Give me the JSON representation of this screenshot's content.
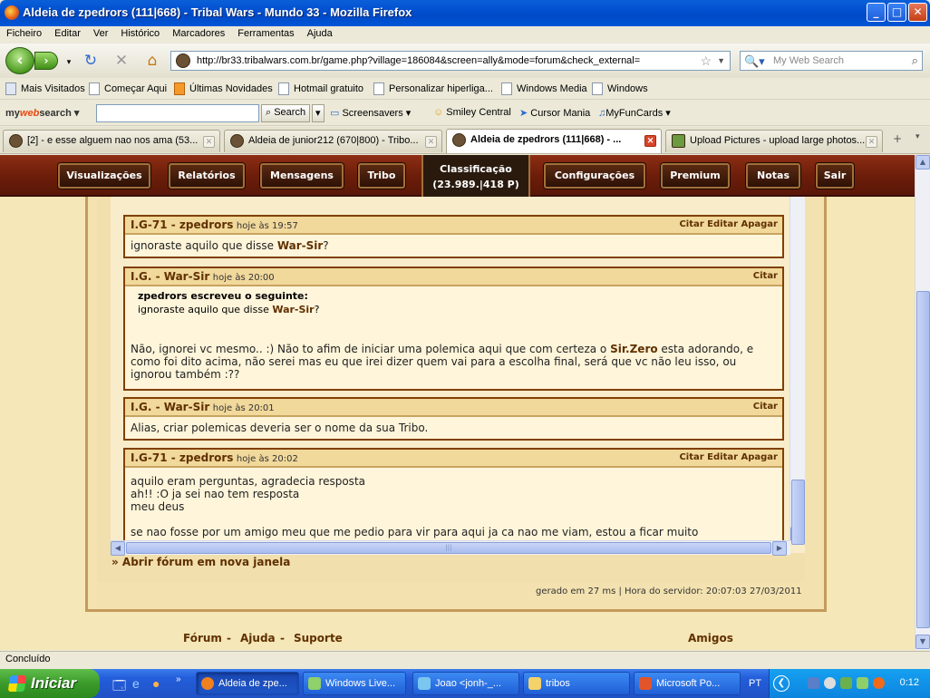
{
  "window": {
    "title": "Aldeia de zpedrors (111|668) - Tribal Wars - Mundo 33 - Mozilla Firefox",
    "controls": {
      "minimize": "_",
      "maximize": "□",
      "close": "✕"
    }
  },
  "menu": [
    "Ficheiro",
    "Editar",
    "Ver",
    "Histórico",
    "Marcadores",
    "Ferramentas",
    "Ajuda"
  ],
  "nav": {
    "url": "http://br33.tribalwars.com.br/game.php?village=186084&screen=ally&mode=forum&check_external=",
    "search_placeholder": "My Web Search"
  },
  "bookmarks": [
    "Mais Visitados",
    "Começar Aqui",
    "Últimas Novidades",
    "Hotmail gratuito",
    "Personalizar hiperliga...",
    "Windows Media",
    "Windows"
  ],
  "mywebsearch": {
    "logo_a": "my",
    "logo_b": "web",
    "logo_c": "search",
    "search_label": "Search",
    "items": [
      "Screensavers",
      "Smiley Central",
      "Cursor Mania",
      "MyFunCards"
    ]
  },
  "tabs": [
    {
      "label": "[2] - e esse alguem nao nos ama (53...",
      "active": false
    },
    {
      "label": "Aldeia de junior212 (670|800) - Tribo...",
      "active": false
    },
    {
      "label": "Aldeia de zpedrors (111|668) - ...",
      "active": true
    },
    {
      "label": "Upload Pictures - upload large photos...",
      "active": false
    }
  ],
  "game_nav": {
    "items": [
      "Visualizações",
      "Relatórios",
      "Mensagens",
      "Tribo",
      "Configurações",
      "Premium",
      "Notas",
      "Sair"
    ],
    "rank_label": "Classificação",
    "rank_value": "(23.989.|418 P)"
  },
  "posts": [
    {
      "author": "I.G-71 - zpedrors",
      "time": "hoje às 19:57",
      "actions": "Citar Editar Apagar",
      "body_pre": "ignoraste aquilo que disse ",
      "body_bold": "War-Sir",
      "body_post": "?"
    },
    {
      "author": "I.G. - War-Sir",
      "time": "hoje às 20:00",
      "actions": "Citar",
      "quote_head": "zpedrors escreveu o seguinte:",
      "quote_pre": "ignoraste aquilo que disse ",
      "quote_bold": "War-Sir",
      "quote_post": "?",
      "body_pre": "Não, ignorei vc mesmo.. :) Não to afim de iniciar uma polemica aqui que com certeza o ",
      "body_bold": "Sir.Zero",
      "body_post": " esta adorando, e como foi dito acima, não serei mas eu que irei dizer quem vai para a escolha final, será que vc não leu isso, ou ignorou também :??"
    },
    {
      "author": "I.G. - War-Sir",
      "time": "hoje às 20:01",
      "actions": "Citar",
      "body": "Alias, criar polemicas deveria ser o nome da sua Tribo."
    },
    {
      "author": "I.G-71 - zpedrors",
      "time": "hoje às 20:02",
      "actions": "Citar Editar Apagar",
      "lines": [
        "aquilo eram perguntas, agradecia resposta",
        "ah!! :O ja sei nao tem resposta",
        "meu deus",
        "",
        "se nao fosse por um amigo meu que me pedio para vir para aqui ja ca nao me viam, estou a ficar muito"
      ]
    }
  ],
  "open_forum": "» Abrir fórum em nova janela",
  "generated": "gerado em 27 ms | Hora do servidor: 20:07:03 27/03/2011",
  "footer": {
    "forum": "Fórum",
    "help": "Ajuda",
    "support": "Suporte",
    "sep": "-",
    "friends": "Amigos"
  },
  "status": "Concluído",
  "taskbar": {
    "start": "Iniciar",
    "tasks": [
      "Aldeia de zpe...",
      "Windows Live...",
      "Joao <jonh-_...",
      "tribos",
      "Microsoft Po..."
    ],
    "lang": "PT",
    "time": "0:12"
  }
}
